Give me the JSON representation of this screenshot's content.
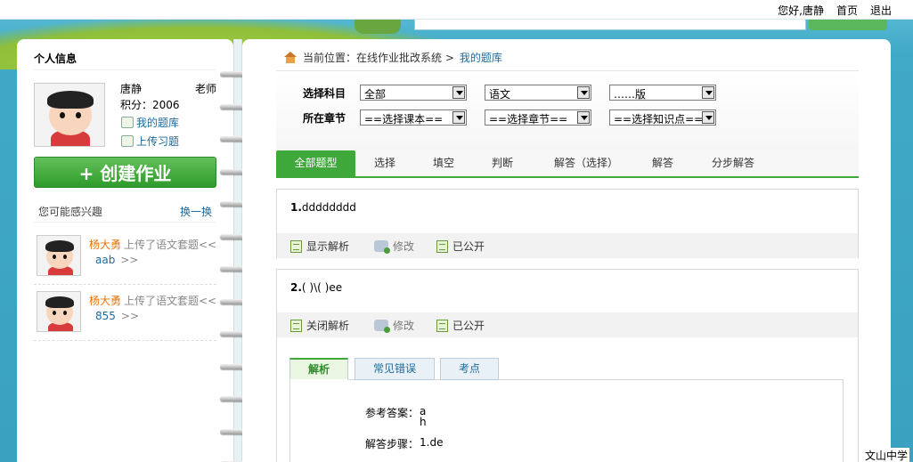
{
  "topbar": {
    "greeting": "您好,唐静",
    "home": "首页",
    "logout": "退出"
  },
  "left": {
    "title": "个人信息",
    "user": {
      "name": "唐静",
      "role": "老师",
      "score": "积分：2006"
    },
    "links": [
      "我的题库",
      "上传习题"
    ],
    "create_button": "+ 创建作业",
    "interest_label": "您可能感兴趣",
    "change_label": "换一换",
    "feed": [
      {
        "name": "杨大勇",
        "action": "上传了语文套题<<",
        "item": "aab",
        "more": ">>"
      },
      {
        "name": "杨大勇",
        "action": "上传了语文套题<<",
        "item": "855",
        "more": ">>"
      }
    ]
  },
  "breadcrumb": {
    "prefix": "当前位置：在线作业批改系统 >",
    "current": "我的题库"
  },
  "filters": {
    "subject_label": "选择科目",
    "chapter_label": "所在章节",
    "subject": "全部",
    "course": "语文",
    "edition": "……版",
    "lesson": "==选择课本==",
    "section": "==选择章节==",
    "knowledge": "==选择知识点=="
  },
  "tabs": [
    "全部题型",
    "选择",
    "填空",
    "判断",
    "解答（选择）",
    "解答",
    "分步解答"
  ],
  "questions": [
    {
      "number": "1.",
      "text": "dddddddd",
      "toggle": "显示解析",
      "edit": "修改",
      "status": "已公开"
    },
    {
      "number": "2.",
      "text": "( )\\( )ee",
      "toggle": "关闭解析",
      "edit": "修改",
      "status": "已公开"
    }
  ],
  "analysis": {
    "tabs": [
      "解析",
      "常见错误",
      "考点"
    ],
    "answer_label": "参考答案：",
    "answer_lines": [
      "a",
      "h"
    ],
    "steps_label": "解答步骤：",
    "steps": "1.de"
  },
  "footer": {
    "school": "文山中学"
  }
}
